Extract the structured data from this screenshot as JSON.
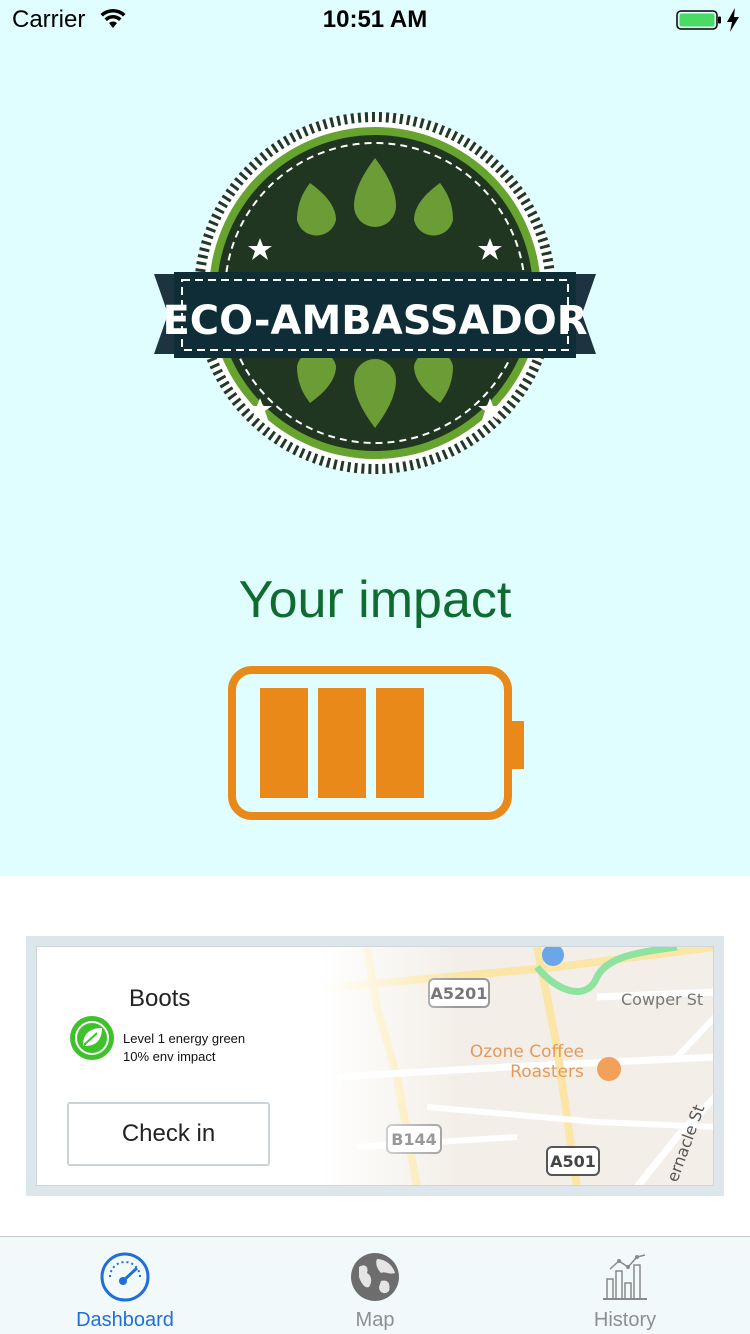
{
  "status_bar": {
    "carrier": "Carrier",
    "time": "10:51 AM"
  },
  "hero": {
    "badge_text": "ECO-AMBASSADOR",
    "title": "Your impact",
    "impact_level": 0.75,
    "accent_color": "#e8891a"
  },
  "store_card": {
    "name": "Boots",
    "eco_level": "Level 1 energy green",
    "impact": "10% env impact",
    "checkin_label": "Check in",
    "map": {
      "road_labels": [
        "A5201",
        "B144",
        "A501"
      ],
      "street_labels": [
        "Cowper St",
        "ernacle St"
      ],
      "poi": [
        "Ozone Coffee",
        "Roasters"
      ]
    }
  },
  "tab_bar": {
    "tabs": [
      {
        "label": "Dashboard",
        "icon": "speedometer-icon",
        "active": true
      },
      {
        "label": "Map",
        "icon": "globe-icon",
        "active": false
      },
      {
        "label": "History",
        "icon": "bar-chart-icon",
        "active": false
      }
    ]
  },
  "colors": {
    "hero_bg": "#e0fdff",
    "title_green": "#0f6b2f",
    "active_tab": "#1f6fd6"
  }
}
